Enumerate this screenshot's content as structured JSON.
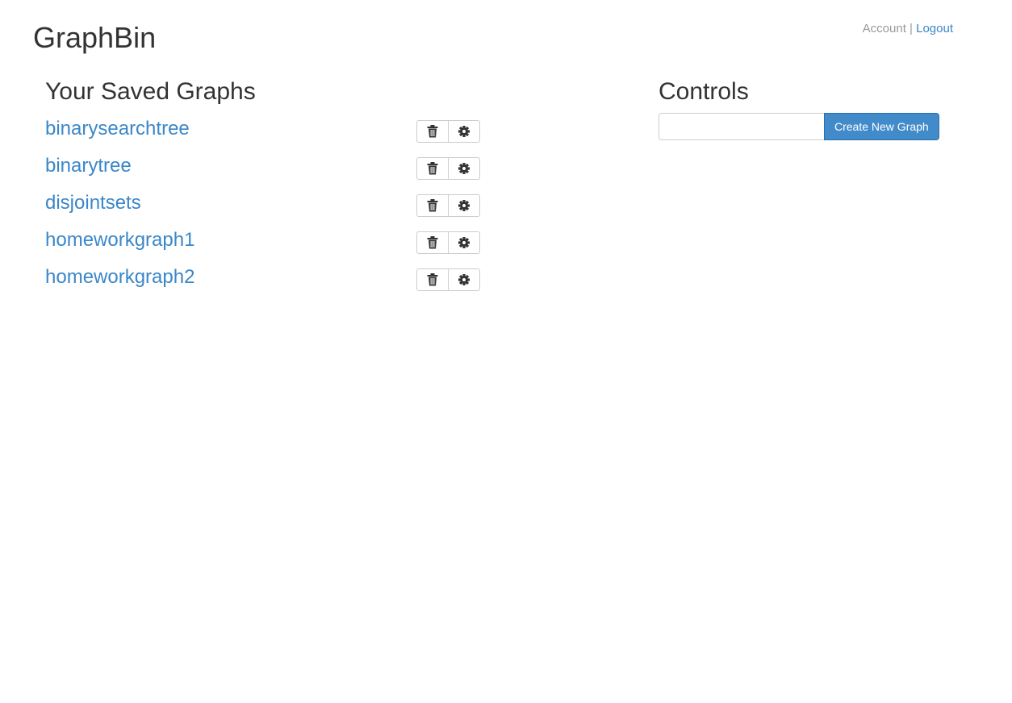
{
  "header": {
    "app_title": "GraphBin",
    "account_label": "Account",
    "separator": "|",
    "logout_label": "Logout"
  },
  "saved_graphs": {
    "heading": "Your Saved Graphs",
    "items": [
      {
        "name": "binarysearchtree"
      },
      {
        "name": "binarytree"
      },
      {
        "name": "disjointsets"
      },
      {
        "name": "homeworkgraph1"
      },
      {
        "name": "homeworkgraph2"
      }
    ],
    "delete_icon": "trash-icon",
    "settings_icon": "gear-icon"
  },
  "controls": {
    "heading": "Controls",
    "graph_name_value": "",
    "create_button_label": "Create New Graph"
  },
  "colors": {
    "link": "#3a87c8",
    "primary_button": "#428bca",
    "muted_text": "#999999",
    "heading_text": "#333333"
  }
}
